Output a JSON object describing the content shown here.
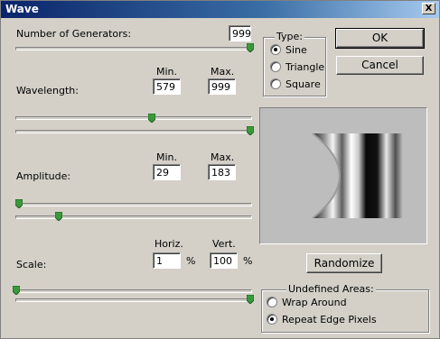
{
  "window": {
    "title": "Wave",
    "close_glyph": "X"
  },
  "generators": {
    "label": "Number of Generators:",
    "value": "999",
    "slider_level": 1.0
  },
  "wavelength": {
    "label": "Wavelength:",
    "min_label": "Min.",
    "max_label": "Max.",
    "min": "579",
    "max": "999",
    "min_level": 0.58,
    "max_level": 1.0
  },
  "amplitude": {
    "label": "Amplitude:",
    "min_label": "Min.",
    "max_label": "Max.",
    "min": "29",
    "max": "183",
    "min_level": 0.03,
    "max_level": 0.18
  },
  "scale": {
    "label": "Scale:",
    "horiz_label": "Horiz.",
    "vert_label": "Vert.",
    "horiz": "1",
    "vert": "100",
    "unit": "%",
    "horiz_level": 0.0,
    "vert_level": 1.0
  },
  "type": {
    "legend": "Type:",
    "options": [
      "Sine",
      "Triangle",
      "Square"
    ],
    "selected": "Sine"
  },
  "buttons": {
    "ok": "OK",
    "cancel": "Cancel",
    "randomize": "Randomize"
  },
  "undefined_areas": {
    "legend": "Undefined Areas:",
    "options": [
      "Wrap Around",
      "Repeat Edge Pixels"
    ],
    "selected": "Repeat Edge Pixels"
  },
  "colors": {
    "titlebar_start": "#0a246a",
    "face": "#d4d0c8",
    "thumb_green": "#3a9a3a"
  }
}
